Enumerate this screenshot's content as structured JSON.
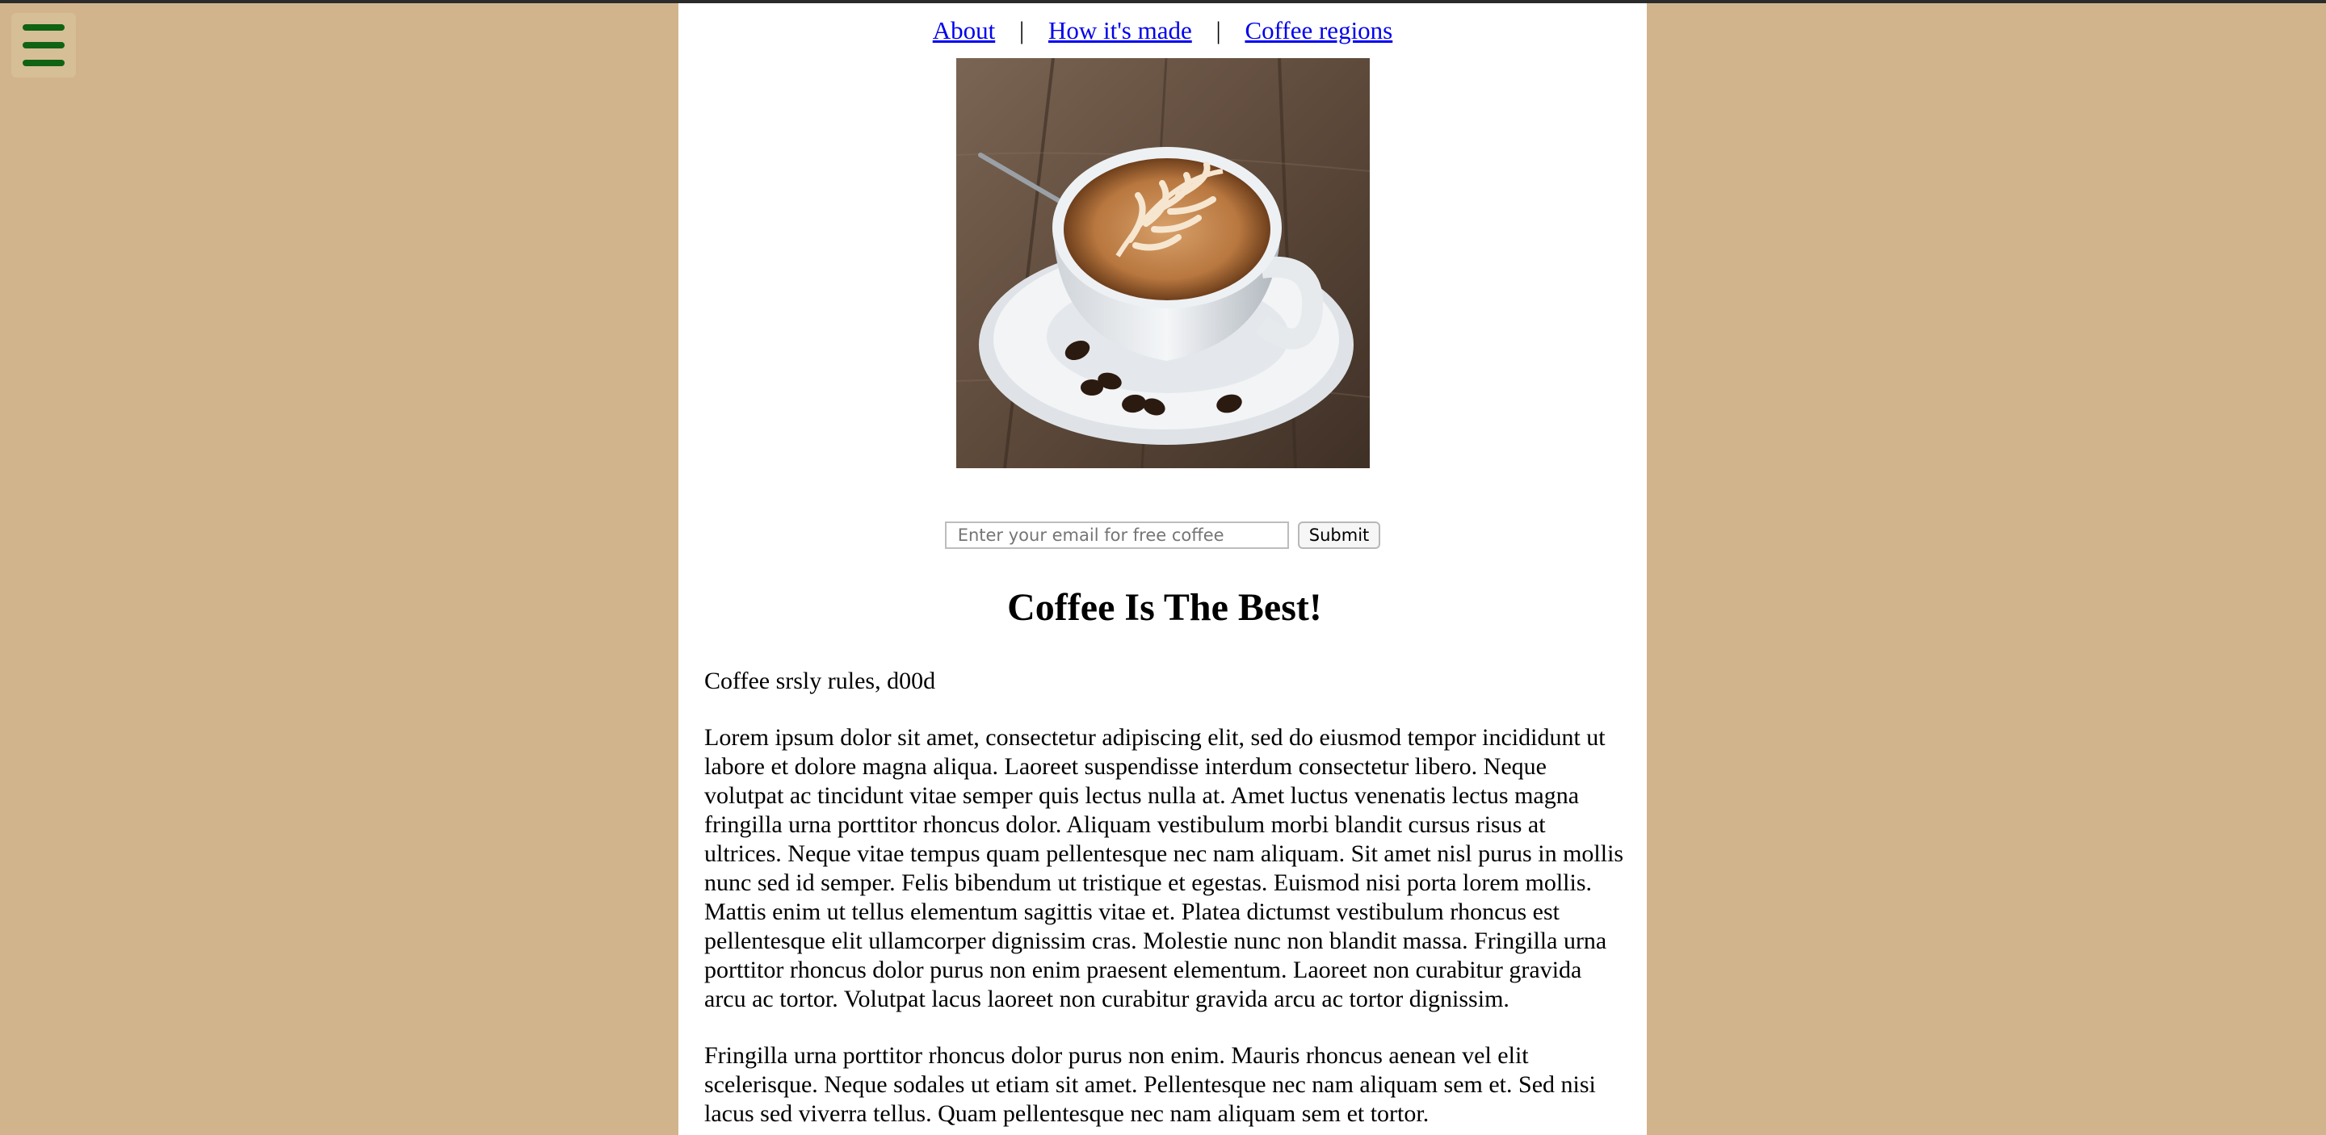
{
  "menu": {
    "icon": "hamburger-menu-icon"
  },
  "nav": {
    "links": [
      {
        "label": "About"
      },
      {
        "label": "How it's made"
      },
      {
        "label": "Coffee regions"
      }
    ],
    "separator": "|"
  },
  "hero": {
    "image": "latte-art-coffee-cup-on-wooden-table"
  },
  "signup": {
    "placeholder": "Enter your email for free coffee",
    "value": "",
    "submit_label": "Submit"
  },
  "article": {
    "title": "Coffee Is The Best!",
    "tagline": "Coffee srsly rules, d00d",
    "paragraphs": [
      "Lorem ipsum dolor sit amet, consectetur adipiscing elit, sed do eiusmod tempor incididunt ut labore et dolore magna aliqua. Laoreet suspendisse interdum consectetur libero. Neque volutpat ac tincidunt vitae semper quis lectus nulla at. Amet luctus venenatis lectus magna fringilla urna porttitor rhoncus dolor. Aliquam vestibulum morbi blandit cursus risus at ultrices. Neque vitae tempus quam pellentesque nec nam aliquam. Sit amet nisl purus in mollis nunc sed id semper. Felis bibendum ut tristique et egestas. Euismod nisi porta lorem mollis. Mattis enim ut tellus elementum sagittis vitae et. Platea dictumst vestibulum rhoncus est pellentesque elit ullamcorper dignissim cras. Molestie nunc non blandit massa. Fringilla urna porttitor rhoncus dolor purus non enim praesent elementum. Laoreet non curabitur gravida arcu ac tortor. Volutpat lacus laoreet non curabitur gravida arcu ac tortor dignissim.",
      "Fringilla urna porttitor rhoncus dolor purus non enim. Mauris rhoncus aenean vel elit scelerisque. Neque sodales ut etiam sit amet. Pellentesque nec nam aliquam sem et. Sed nisi lacus sed viverra tellus. Quam pellentesque nec nam aliquam sem et tortor."
    ]
  },
  "colors": {
    "background": "#d2b48c",
    "page": "#ffffff",
    "link": "#0000ee",
    "menu_icon": "#0f6313"
  }
}
